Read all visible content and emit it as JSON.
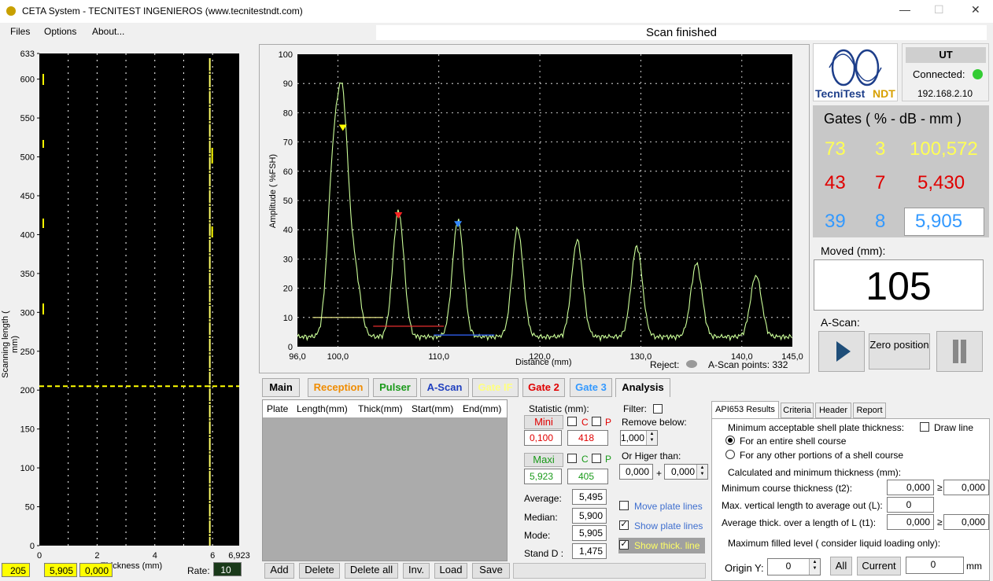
{
  "window": {
    "title": "CETA System - TECNITEST INGENIEROS (www.tecnitestndt.com)",
    "minimize": "—",
    "maximize": "☐",
    "close": "✕"
  },
  "menu": {
    "files": "Files",
    "options": "Options",
    "about": "About..."
  },
  "status": "Scan finished",
  "cscan": {
    "y_ticks": [
      "633",
      "600",
      "550",
      "500",
      "450",
      "400",
      "350",
      "300",
      "250",
      "200",
      "150",
      "100",
      "50",
      "0"
    ],
    "x_ticks": [
      "0",
      "2",
      "4",
      "6",
      "6,923"
    ],
    "ylabel": "Scanning length ( mm)",
    "xlabel": "Thickness (mm)",
    "bottom": {
      "pos": "205",
      "thick": "5,905",
      "val": "0,000",
      "rate_label": "Rate:",
      "rate": "10"
    }
  },
  "ascan": {
    "ylabel": "Amplitude ( %FSH)",
    "xlabel": "Distance (mm)",
    "reject_label": "Reject:",
    "points_label": "A-Scan points: 332"
  },
  "chart_data": {
    "type": "line",
    "xlim": [
      96.0,
      145.0
    ],
    "ylim": [
      0,
      100
    ],
    "x_ticks": [
      "96,0",
      "100,0",
      "110,0",
      "120,0",
      "130,0",
      "140,0",
      "145,0"
    ],
    "y_ticks": [
      "0",
      "10",
      "20",
      "30",
      "40",
      "50",
      "60",
      "70",
      "80",
      "90",
      "100"
    ],
    "xlabel": "Distance (mm)",
    "ylabel": "Amplitude ( %FSH)",
    "series": [
      {
        "peaks": [
          [
            99.5,
            52
          ],
          [
            100.5,
            73
          ],
          [
            101.7,
            21
          ],
          [
            106.0,
            43
          ],
          [
            111.9,
            40
          ],
          [
            117.8,
            37
          ],
          [
            123.7,
            33
          ],
          [
            129.6,
            31
          ],
          [
            135.5,
            25
          ],
          [
            141.4,
            21
          ]
        ]
      }
    ],
    "gates": [
      {
        "color": "#ffff99",
        "x0": 97.5,
        "x1": 104.5,
        "level": 10
      },
      {
        "color": "#ff3333",
        "x0": 103.5,
        "x1": 110.5,
        "level": 7
      },
      {
        "color": "#3366ff",
        "x0": 109.5,
        "x1": 115.5,
        "level": 4
      }
    ]
  },
  "device": {
    "ut": "UT",
    "connected": "Connected:",
    "ip": "192.168.2.10",
    "logo_text1": "TecniTest",
    "logo_text2": "NDT"
  },
  "gates_panel": {
    "title": "Gates  ( % - dB - mm )",
    "rows": [
      {
        "pct": "73",
        "db": "3",
        "mm": "100,572",
        "color": "#ffff55"
      },
      {
        "pct": "43",
        "db": "7",
        "mm": "5,430",
        "color": "#e00000"
      },
      {
        "pct": "39",
        "db": "8",
        "mm": "5,905",
        "color": "#3399ff"
      }
    ]
  },
  "moved": {
    "label": "Moved (mm):",
    "value": "105"
  },
  "ascan_ctrl": {
    "label": "A-Scan:",
    "zero": "Zero position"
  },
  "tabs": [
    "Main",
    "Reception",
    "Pulser",
    "A-Scan",
    "Gate IF",
    "Gate 2",
    "Gate 3",
    "Analysis"
  ],
  "table": {
    "headers": [
      "Plate",
      "Length(mm)",
      "Thick(mm)",
      "Start(mm)",
      "End(mm)"
    ]
  },
  "stats": {
    "title": "Statistic (mm):",
    "mini": "Mini",
    "mini_val": "0,100",
    "mini_count": "418",
    "maxi": "Maxi",
    "maxi_val": "5,923",
    "maxi_count": "405",
    "c": "C",
    "p": "P",
    "average_label": "Average:",
    "average": "5,495",
    "median_label": "Median:",
    "median": "5,900",
    "mode_label": "Mode:",
    "mode": "5,905",
    "std_label": "Stand D :",
    "std": "1,475"
  },
  "filter": {
    "label": "Filter:",
    "remove_below": "Remove below:",
    "below_val": "1,000",
    "higher": "Or Higer than:",
    "h1": "0,000",
    "plus": "+",
    "h2": "0,000",
    "move_lines": "Move plate lines",
    "show_lines": "Show plate lines",
    "show_thick": "Show thick. line"
  },
  "bottom_btns": {
    "add": "Add",
    "delete": "Delete",
    "delete_all": "Delete all",
    "inv": "Inv.",
    "load": "Load",
    "save": "Save"
  },
  "api": {
    "tabs": [
      "API653 Results",
      "Criteria",
      "Header",
      "Report"
    ],
    "min_title": "Minimum acceptable shell plate thickness:",
    "draw_line": "Draw line",
    "opt1": "For an entire shell course",
    "opt2": "For any other portions of a shell course",
    "calc_title": "Calculated and minimum thickness (mm):",
    "t2_label": "Minimum course thickness (t2):",
    "t2": "0,000",
    "t2_min": "0,000",
    "ge": "≥",
    "l_label": "Max. vertical length to average out (L):",
    "l": "0",
    "t1_label": "Average thick. over a length of L (t1):",
    "t1": "0,000",
    "t1_min": "0,000",
    "fill_title": "Maximum filled level ( consider liquid loading only):",
    "origin_label": "Origin Y:",
    "origin": "0",
    "all": "All",
    "current": "Current",
    "current_val": "0",
    "mm": "mm"
  }
}
